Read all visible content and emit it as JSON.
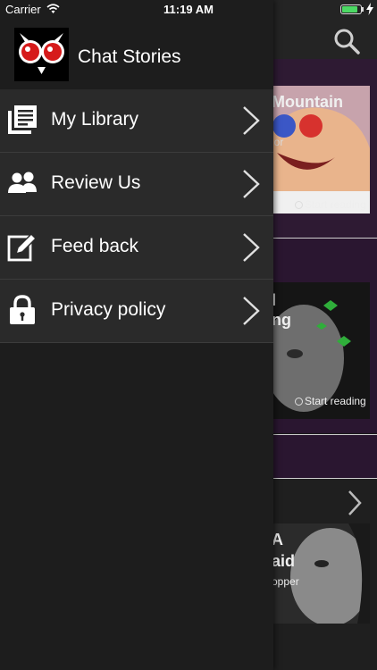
{
  "status_bar": {
    "carrier": "Carrier",
    "time": "11:19 AM",
    "battery_level": 0.85
  },
  "drawer": {
    "app_title": "Chat Stories",
    "menu_items": [
      {
        "label": "My Library",
        "icon": "library-icon"
      },
      {
        "label": "Review Us",
        "icon": "people-icon"
      },
      {
        "label": "Feed back",
        "icon": "edit-icon"
      },
      {
        "label": "Privacy policy",
        "icon": "lock-icon"
      }
    ]
  },
  "background": {
    "story1_title": "Mountain",
    "story1_subtitle": "ior",
    "story2_title_line1": "l",
    "story2_title_line2": "ng",
    "story3_title_line1": "A",
    "story3_title_line2": "aid",
    "story3_subtitle": "opper",
    "start_reading": "Start reading"
  },
  "colors": {
    "drawer_bg": "#1d1d1d",
    "menu_item_bg": "#2a2a2a",
    "accent_battery": "#4cd964",
    "story_panel_bg": "#2a1630"
  }
}
